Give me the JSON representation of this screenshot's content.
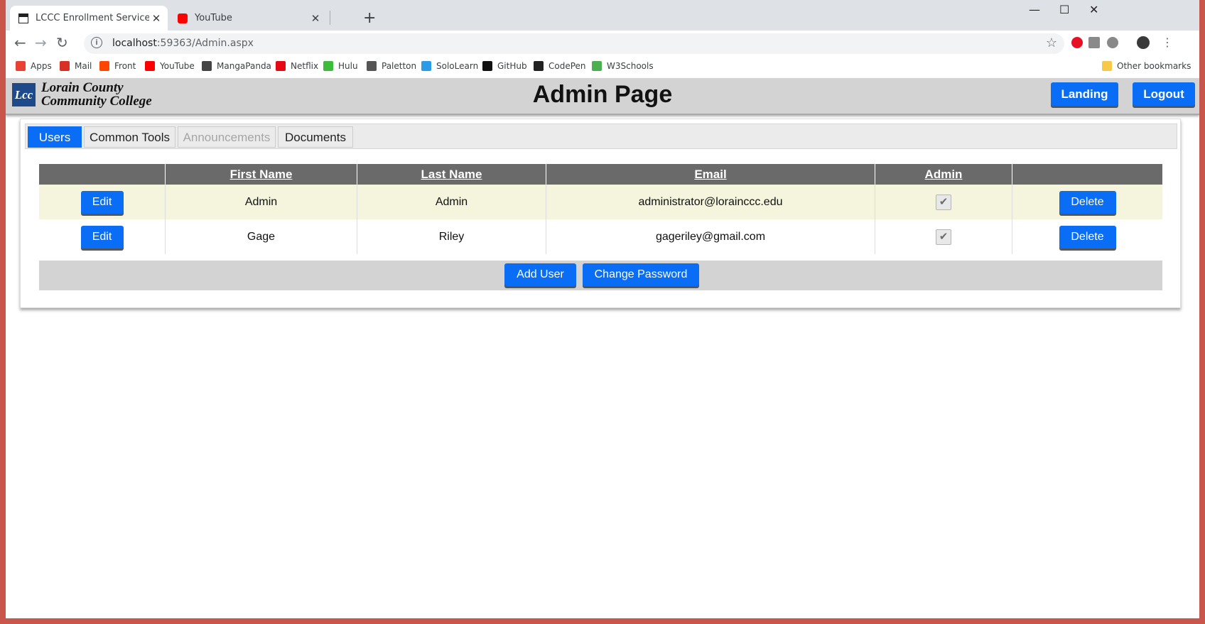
{
  "browser": {
    "tabs": [
      {
        "title": "LCCC Enrollment Services Admin",
        "close": "✕"
      },
      {
        "title": "YouTube",
        "close": "✕"
      }
    ],
    "new_tab": "+",
    "window_controls": {
      "minimize": "—",
      "maximize": "☐",
      "close": "✕"
    },
    "nav": {
      "back": "←",
      "forward": "→",
      "reload": "↻"
    },
    "url_host": "localhost",
    "url_rest": ":59363/Admin.aspx",
    "bookmarks": [
      {
        "label": "Apps",
        "icon": "apps-grid-icon",
        "color": "#e94235"
      },
      {
        "label": "Mail",
        "icon": "gmail-icon",
        "color": "#d93025"
      },
      {
        "label": "Front",
        "icon": "reddit-icon",
        "color": "#ff4500"
      },
      {
        "label": "YouTube",
        "icon": "youtube-icon",
        "color": "#ff0000"
      },
      {
        "label": "MangaPanda",
        "icon": "mangapanda-icon",
        "color": "#444444"
      },
      {
        "label": "Netflix",
        "icon": "netflix-icon",
        "color": "#e50914"
      },
      {
        "label": "Hulu",
        "icon": "hulu-icon",
        "color": "#3dbb3d"
      },
      {
        "label": "Paletton",
        "icon": "paletton-icon",
        "color": "#555555"
      },
      {
        "label": "SoloLearn",
        "icon": "sololearn-icon",
        "color": "#2b9be8"
      },
      {
        "label": "GitHub",
        "icon": "github-icon",
        "color": "#111111"
      },
      {
        "label": "CodePen",
        "icon": "codepen-icon",
        "color": "#222222"
      },
      {
        "label": "W3Schools",
        "icon": "w3schools-icon",
        "color": "#4caf50"
      }
    ],
    "other_bookmarks": "Other bookmarks"
  },
  "header": {
    "logo_mark": "Lcc",
    "logo_line1": "Lorain County",
    "logo_line2": "Community College",
    "title": "Admin Page",
    "landing_label": "Landing",
    "logout_label": "Logout"
  },
  "page_tabs": [
    {
      "label": "Users",
      "state": "active"
    },
    {
      "label": "Common Tools",
      "state": "normal"
    },
    {
      "label": "Announcements",
      "state": "disabled"
    },
    {
      "label": "Documents",
      "state": "normal"
    }
  ],
  "grid": {
    "columns": [
      "",
      "First Name",
      "Last Name",
      "Email",
      "Admin",
      ""
    ],
    "edit_label": "Edit",
    "delete_label": "Delete",
    "rows": [
      {
        "first": "Admin",
        "last": "Admin",
        "email": "administrator@lorainccc.edu",
        "admin": true
      },
      {
        "first": "Gage",
        "last": "Riley",
        "email": "gageriley@gmail.com",
        "admin": true
      }
    ]
  },
  "actions": {
    "add_user": "Add User",
    "change_password": "Change Password"
  }
}
